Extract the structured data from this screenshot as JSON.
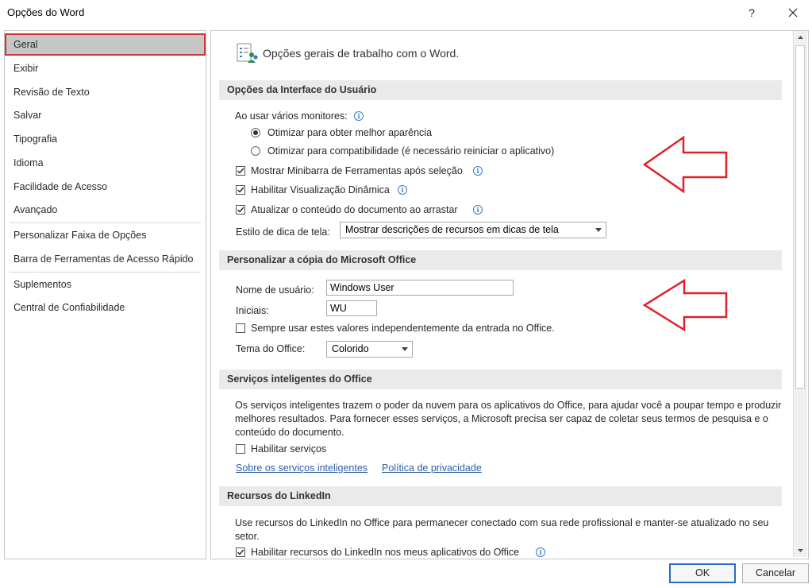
{
  "window": {
    "title": "Opções do Word",
    "help_label": "?"
  },
  "sidebar": {
    "items": [
      {
        "label": "Geral"
      },
      {
        "label": "Exibir"
      },
      {
        "label": "Revisão de Texto"
      },
      {
        "label": "Salvar"
      },
      {
        "label": "Tipografia"
      },
      {
        "label": "Idioma"
      },
      {
        "label": "Facilidade de Acesso"
      },
      {
        "label": "Avançado"
      },
      {
        "label": "Personalizar Faixa de Opções"
      },
      {
        "label": "Barra de Ferramentas de Acesso Rápido"
      },
      {
        "label": "Suplementos"
      },
      {
        "label": "Central de Confiabilidade"
      }
    ],
    "selected": "Geral"
  },
  "main": {
    "header": "Opções gerais de trabalho com o Word.",
    "ui_section": {
      "title": "Opções da Interface do Usuário",
      "monitors_label": "Ao usar vários monitores:",
      "radio_best": "Otimizar para obter melhor aparência",
      "radio_compat": "Otimizar para compatibilidade (é necessário reiniciar o aplicativo)",
      "mini_toolbar": "Mostrar Minibarra de Ferramentas após seleção",
      "live_preview": "Habilitar Visualização Dinâmica",
      "update_drag": "Atualizar o conteúdo do documento ao arrastar",
      "tooltip_style_label": "Estilo de dica de tela:",
      "tooltip_style_value": "Mostrar descrições de recursos em dicas de tela"
    },
    "copy_section": {
      "title": "Personalizar a cópia do Microsoft Office",
      "username_label": "Nome de usuário:",
      "username_value": "Windows User",
      "initials_label": "Iniciais:",
      "initials_value": "WU",
      "always_use": "Sempre usar estes valores independentemente da entrada no Office.",
      "theme_label": "Tema do Office:",
      "theme_value": "Colorido"
    },
    "intelligent_section": {
      "title": "Serviços inteligentes do Office",
      "description": "Os serviços inteligentes trazem o poder da nuvem para os aplicativos do Office, para ajudar você a poupar tempo e produzir melhores resultados. Para fornecer esses serviços, a Microsoft precisa ser capaz de coletar seus termos de pesquisa e o conteúdo do documento.",
      "enable": "Habilitar serviços",
      "link_about": "Sobre os serviços inteligentes",
      "link_privacy": "Política de privacidade"
    },
    "linkedin_section": {
      "title": "Recursos do LinkedIn",
      "description": "Use recursos do LinkedIn no Office para permanecer conectado com sua rede profissional e manter-se atualizado no seu setor.",
      "enable": "Habilitar recursos do LinkedIn nos meus aplicativos do Office"
    }
  },
  "buttons": {
    "ok": "OK",
    "cancel": "Cancelar"
  },
  "colors": {
    "annotation_arrow": "#e0202a",
    "selection_border": "#d13438",
    "link": "#2e5fa6"
  }
}
